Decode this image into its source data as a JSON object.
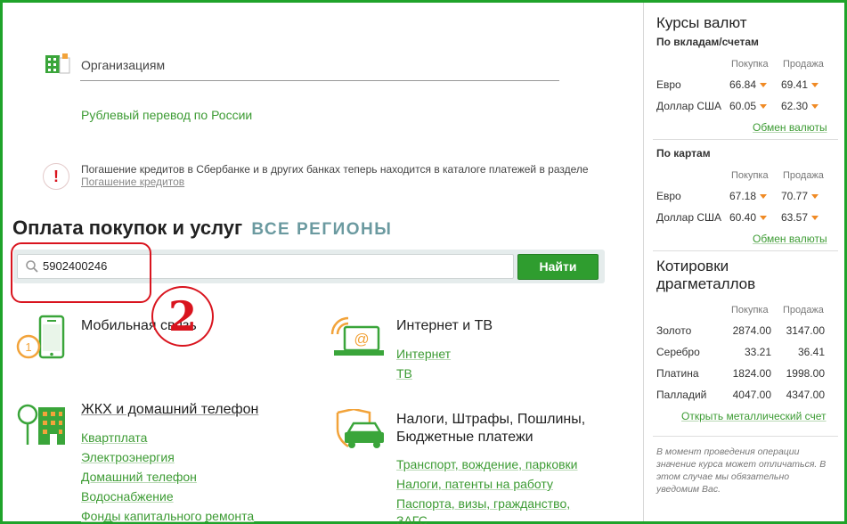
{
  "organizations": {
    "label": "Организациям",
    "ruble_transfer_link": "Рублевый перевод по России"
  },
  "notice": {
    "text": "Погашение кредитов в Сбербанке и в других банках теперь находится в каталоге платежей в разделе",
    "link": "Погашение кредитов"
  },
  "payments": {
    "title": "Оплата покупок и услуг",
    "regions": "ВСЕ РЕГИОНЫ",
    "search_value": "5902400246",
    "find_button": "Найти",
    "annotation_number": "2"
  },
  "categories": {
    "mobile": {
      "title": "Мобильная связь"
    },
    "internet": {
      "title": "Интернет и ТВ",
      "links": [
        "Интернет",
        "ТВ"
      ]
    },
    "housing": {
      "title": "ЖКХ и домашний телефон",
      "links": [
        "Квартплата",
        "Электроэнергия",
        "Домашний телефон",
        "Водоснабжение",
        "Фонды капитального ремонта"
      ]
    },
    "taxes": {
      "title_line1": "Налоги, Штрафы, Пошлины,",
      "title_line2": "Бюджетные платежи",
      "links": [
        "Транспорт, вождение, парковки",
        "Налоги, патенты на работу",
        "Паспорта, визы, гражданство,",
        "ЗАГС"
      ]
    }
  },
  "rates": {
    "title": "Курсы валют",
    "deposits": {
      "subtitle": "По вкладам/счетам",
      "col_buy": "Покупка",
      "col_sell": "Продажа",
      "rows": [
        {
          "name": "Евро",
          "buy": "66.84",
          "sell": "69.41"
        },
        {
          "name": "Доллар США",
          "buy": "60.05",
          "sell": "62.30"
        }
      ],
      "more": "Обмен валюты"
    },
    "cards": {
      "subtitle": "По картам",
      "col_buy": "Покупка",
      "col_sell": "Продажа",
      "rows": [
        {
          "name": "Евро",
          "buy": "67.18",
          "sell": "70.77"
        },
        {
          "name": "Доллар США",
          "buy": "60.40",
          "sell": "63.57"
        }
      ],
      "more": "Обмен валюты"
    }
  },
  "metals": {
    "title_line1": "Котировки",
    "title_line2": "драгметаллов",
    "col_buy": "Покупка",
    "col_sell": "Продажа",
    "rows": [
      {
        "name": "Золото",
        "buy": "2874.00",
        "sell": "3147.00"
      },
      {
        "name": "Серебро",
        "buy": "33.21",
        "sell": "36.41"
      },
      {
        "name": "Платина",
        "buy": "1824.00",
        "sell": "1998.00"
      },
      {
        "name": "Палладий",
        "buy": "4047.00",
        "sell": "4347.00"
      }
    ],
    "link": "Открыть металлический счет",
    "note": "В момент проведения операции значение курса может отличаться. В этом случае мы обязательно уведомим Вас."
  },
  "colors": {
    "frame": "#1fa32a",
    "link": "#3c9b33",
    "button": "#2f9d2f",
    "annotation": "#d9141e",
    "arrow": "#f08a24",
    "regions": "#6b9aa0"
  }
}
